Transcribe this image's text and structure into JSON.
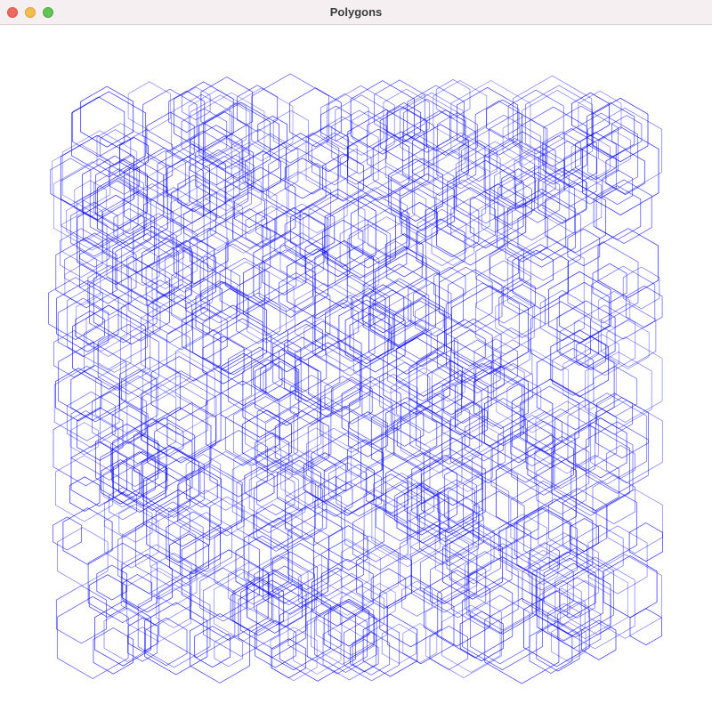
{
  "window": {
    "title": "Polygons",
    "controls": {
      "close": "close-button",
      "minimize": "minimize-button",
      "zoom": "zoom-button"
    }
  },
  "drawing": {
    "shape": "hexagon",
    "stroke_color": "#0000ff",
    "fill": "none",
    "colors": {
      "close": "#ee6a5f",
      "minimize": "#f5bd4f",
      "zoom": "#61c455",
      "titlebar": "#f6eff1",
      "background": "#ffffff"
    }
  }
}
